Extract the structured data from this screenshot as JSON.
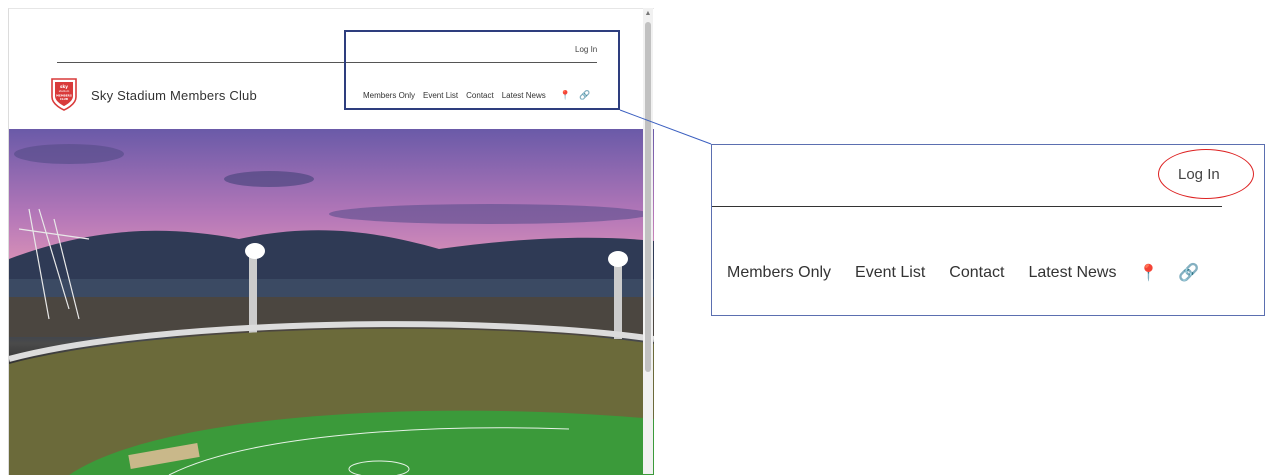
{
  "header": {
    "login_label": "Log In",
    "club_name": "Sky Stadium Members Club",
    "logo_text": [
      "sky",
      "stadium",
      "MEMBERS",
      "CLUB"
    ],
    "nav": [
      {
        "label": "Members Only"
      },
      {
        "label": "Event List"
      },
      {
        "label": "Contact"
      },
      {
        "label": "Latest News"
      }
    ],
    "location_icon": "map-pin-icon",
    "link_icon": "link-icon"
  },
  "zoom": {
    "login_label": "Log In",
    "nav": [
      {
        "label": "Members Only"
      },
      {
        "label": "Event List"
      },
      {
        "label": "Contact"
      },
      {
        "label": "Latest News"
      }
    ]
  },
  "colors": {
    "callout_border": "#2e3e7e",
    "highlight_oval": "#dd2222",
    "logo_red": "#d93a3a"
  }
}
